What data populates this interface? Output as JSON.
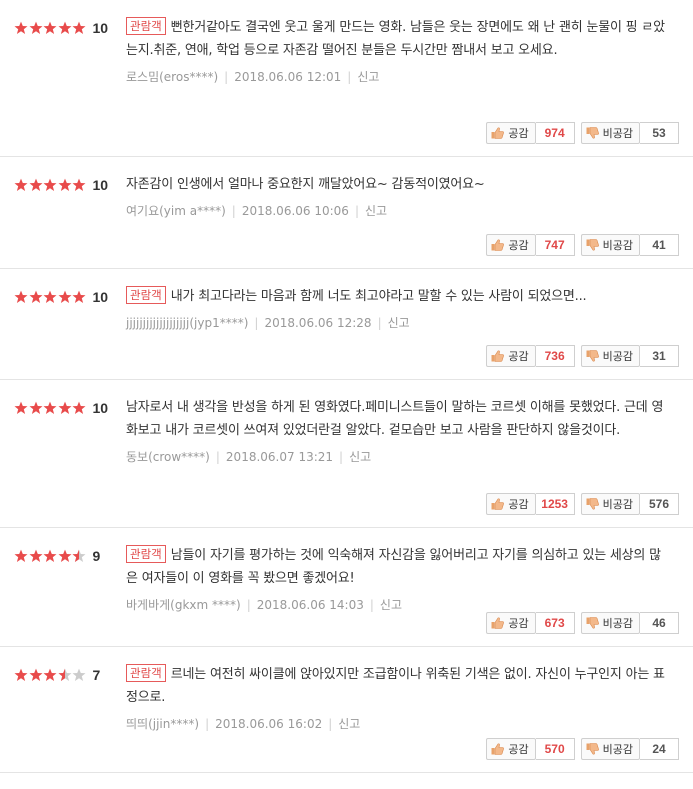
{
  "labels": {
    "like": "공감",
    "dislike": "비공감",
    "report": "신고",
    "viewer_badge": "관람객"
  },
  "colors": {
    "star_on": "#e84b4b",
    "star_off": "#cccccc",
    "badge": "#e04848"
  },
  "reviews": [
    {
      "rating": 10,
      "stars": 5,
      "viewer": true,
      "text": "뻔한거같아도 결국엔 웃고 울게 만드는 영화. 남들은 웃는 장면에도 왜 난 괜히 눈물이 핑 ㄹ았는지.취준, 연애, 학업 등으로 자존감 떨어진 분들은 두시간만 짬내서 보고 오세요.",
      "user": "로스밈(eros****)",
      "date": "2018.06.06 12:01",
      "likes": "974",
      "dislikes": "53"
    },
    {
      "rating": 10,
      "stars": 5,
      "viewer": false,
      "text": "자존감이 인생에서 얼마나 중요한지 깨달았어요~ 감동적이였어요~",
      "user": "여기요(yim a****)",
      "date": "2018.06.06 10:06",
      "likes": "747",
      "dislikes": "41"
    },
    {
      "rating": 10,
      "stars": 5,
      "viewer": true,
      "text": "내가 최고다라는 마음과 함께 너도 최고야라고 말할 수 있는 사람이 되었으면...",
      "user": "jjjjjjjjjjjjjjjjjjj(jyp1****)",
      "date": "2018.06.06 12:28",
      "likes": "736",
      "dislikes": "31"
    },
    {
      "rating": 10,
      "stars": 5,
      "viewer": false,
      "text": "남자로서 내 생각을 반성을 하게 된 영화였다.페미니스트들이 말하는 코르셋 이해를 못했었다. 근데 영화보고 내가 코르셋이 쓰여져 있었더란걸 알았다. 겉모습만 보고 사람을 판단하지 않을것이다.",
      "user": "동보(crow****)",
      "date": "2018.06.07 13:21",
      "likes": "1253",
      "dislikes": "576"
    },
    {
      "rating": 9,
      "stars": 4.5,
      "viewer": true,
      "text": "남들이 자기를 평가하는 것에 익숙해져 자신감을 잃어버리고 자기를 의심하고 있는 세상의 많은 여자들이 이 영화를 꼭 봤으면 좋겠어요!",
      "user": "바게바게(gkxm ****)",
      "date": "2018.06.06 14:03",
      "likes": "673",
      "dislikes": "46"
    },
    {
      "rating": 7,
      "stars": 3.5,
      "viewer": true,
      "text": "르네는 여전히 싸이클에 앉아있지만 조급함이나 위축된 기색은 없이. 자신이 누구인지 아는 표정으로.",
      "user": "띄띄(jjin****)",
      "date": "2018.06.06 16:02",
      "likes": "570",
      "dislikes": "24"
    }
  ]
}
